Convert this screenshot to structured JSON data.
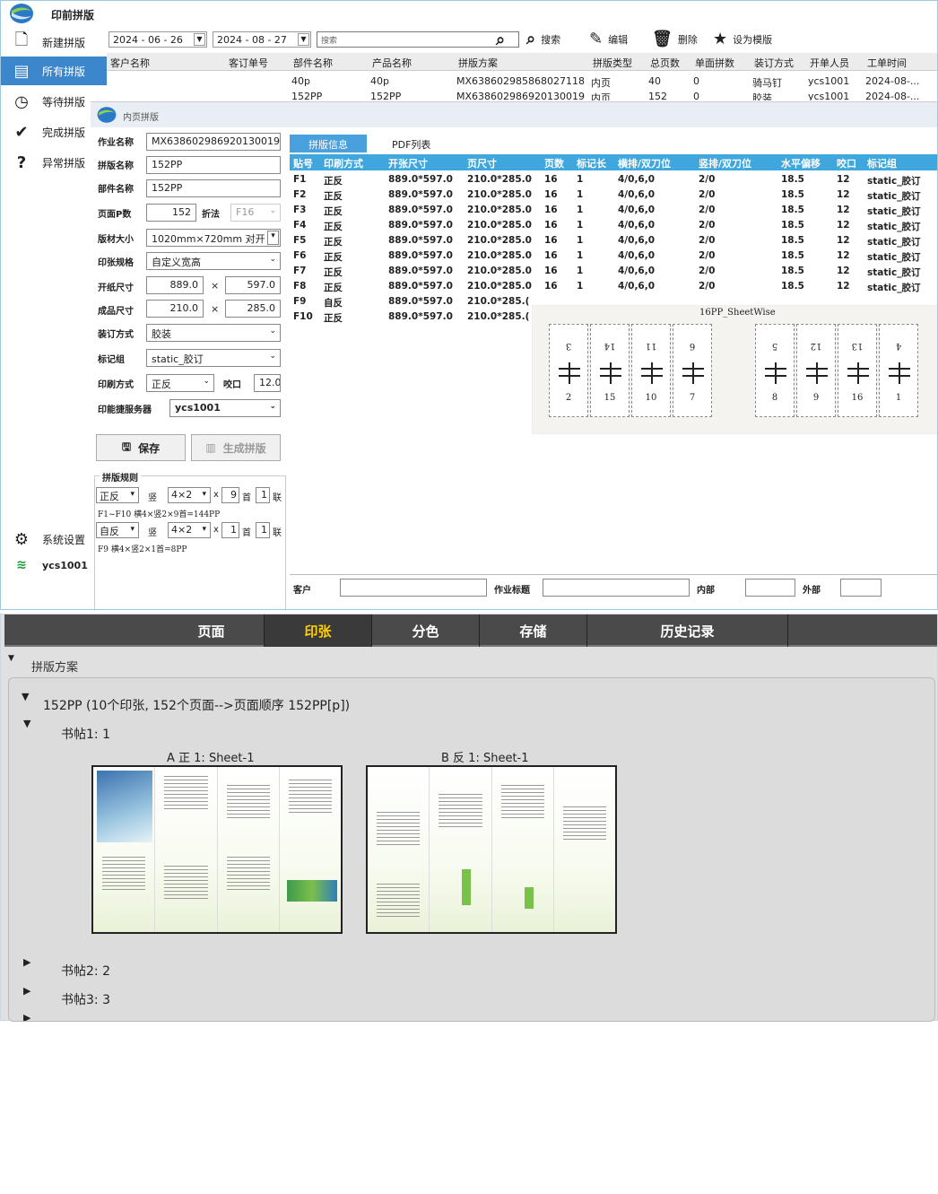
{
  "app": {
    "title": "印前拼版",
    "user": "ycs1001"
  },
  "nav": [
    {
      "label": "新建拼版",
      "icon": "new-file-icon",
      "glyph": "🗋"
    },
    {
      "label": "所有拼版",
      "icon": "list-icon",
      "glyph": "▤"
    },
    {
      "label": "等待拼版",
      "icon": "clock-icon",
      "glyph": "◷"
    },
    {
      "label": "完成拼版",
      "icon": "check-icon",
      "glyph": "✔"
    },
    {
      "label": "异常拼版",
      "icon": "question-icon",
      "glyph": "?"
    }
  ],
  "settings": {
    "label": "系统设置"
  },
  "toolbar": {
    "date_from": "2024 - 06 - 26",
    "date_to": "2024 - 08 - 27",
    "search_placeholder": "搜索",
    "search_label": "搜索",
    "edit_label": "编辑",
    "delete_label": "删除",
    "template_label": "设为模版"
  },
  "list": {
    "headers": [
      "客户名称",
      "客订单号",
      "部件名称",
      "产品名称",
      "拼版方案",
      "拼版类型",
      "总页数",
      "单面拼数",
      "装订方式",
      "开单人员",
      "工单时间"
    ],
    "rows": [
      [
        "",
        "",
        "40p",
        "40p",
        "MX638602985868027118",
        "内页",
        "40",
        "0",
        "骑马钉",
        "ycs1001",
        "2024-08-..."
      ],
      [
        "",
        "",
        "152PP",
        "152PP",
        "MX638602986920130019",
        "内页",
        "152",
        "0",
        "胶装",
        "ycs1001",
        "2024-08-..."
      ]
    ]
  },
  "dialog": {
    "title": "内页拼版",
    "job_name_label": "作业名称",
    "job_name": "MX638602986920130019",
    "layout_name_label": "拼版名称",
    "layout_name": "152PP",
    "part_name_label": "部件名称",
    "part_name": "152PP",
    "pages_label": "页面P数",
    "pages": "152",
    "fold_label": "折法",
    "fold": "F16",
    "plate_label": "版材大小",
    "plate": "1020mm×720mm 对开",
    "sheet_spec_label": "印张规格",
    "sheet_spec": "自定义宽高",
    "open_size_label": "开纸尺寸",
    "open_w": "889.0",
    "open_h": "597.0",
    "final_size_label": "成品尺寸",
    "final_w": "210.0",
    "final_h": "285.0",
    "times": "×",
    "binding_label": "装订方式",
    "binding": "胶装",
    "mark_group_label": "标记组",
    "mark_group": "static_胶订",
    "print_mode_label": "印刷方式",
    "print_mode": "正反",
    "gripper_label": "咬口",
    "gripper": "12.0",
    "server_label": "印能捷服务器",
    "server": "ycs1001",
    "save_label": "保存",
    "generate_label": "生成拼版",
    "rules_title": "拼版规则",
    "rules": [
      {
        "mode": "正反",
        "orient": "竖",
        "grid": "4×2",
        "x": "x",
        "count": "9",
        "shou": "首",
        "lian_n": "1",
        "lian": "联",
        "desc": "F1~F10 横4×竖2×9首=144PP"
      },
      {
        "mode": "自反",
        "orient": "竖",
        "grid": "4×2",
        "x": "x",
        "count": "1",
        "shou": "首",
        "lian_n": "1",
        "lian": "联",
        "desc": "F9 横4×竖2×1首=8PP"
      }
    ]
  },
  "tabs": [
    "拼版信息",
    "PDF列表"
  ],
  "grid": {
    "headers": [
      "贴号",
      "印刷方式",
      "开张尺寸",
      "页尺寸",
      "页数",
      "标记长",
      "横排/双刀位",
      "竖排/双刀位",
      "水平偏移",
      "咬口",
      "标记组"
    ],
    "rows": [
      [
        "F1",
        "正反",
        "889.0*597.0",
        "210.0*285.0",
        "16",
        "1",
        "4/0,6,0",
        "2/0",
        "18.5",
        "12",
        "static_胶订"
      ],
      [
        "F2",
        "正反",
        "889.0*597.0",
        "210.0*285.0",
        "16",
        "1",
        "4/0,6,0",
        "2/0",
        "18.5",
        "12",
        "static_胶订"
      ],
      [
        "F3",
        "正反",
        "889.0*597.0",
        "210.0*285.0",
        "16",
        "1",
        "4/0,6,0",
        "2/0",
        "18.5",
        "12",
        "static_胶订"
      ],
      [
        "F4",
        "正反",
        "889.0*597.0",
        "210.0*285.0",
        "16",
        "1",
        "4/0,6,0",
        "2/0",
        "18.5",
        "12",
        "static_胶订"
      ],
      [
        "F5",
        "正反",
        "889.0*597.0",
        "210.0*285.0",
        "16",
        "1",
        "4/0,6,0",
        "2/0",
        "18.5",
        "12",
        "static_胶订"
      ],
      [
        "F6",
        "正反",
        "889.0*597.0",
        "210.0*285.0",
        "16",
        "1",
        "4/0,6,0",
        "2/0",
        "18.5",
        "12",
        "static_胶订"
      ],
      [
        "F7",
        "正反",
        "889.0*597.0",
        "210.0*285.0",
        "16",
        "1",
        "4/0,6,0",
        "2/0",
        "18.5",
        "12",
        "static_胶订"
      ],
      [
        "F8",
        "正反",
        "889.0*597.0",
        "210.0*285.0",
        "16",
        "1",
        "4/0,6,0",
        "2/0",
        "18.5",
        "12",
        "static_胶订"
      ],
      [
        "F9",
        "自反",
        "889.0*597.0",
        "210.0*285.("
      ],
      [
        "F10",
        "正反",
        "889.0*597.0",
        "210.0*285.("
      ]
    ]
  },
  "imposition": {
    "title": "16PP_SheetWise",
    "top": [
      "3",
      "14",
      "11",
      "6",
      "5",
      "12",
      "13",
      "4"
    ],
    "bottom": [
      "2",
      "15",
      "10",
      "7",
      "8",
      "9",
      "16",
      "1"
    ]
  },
  "footer": {
    "customer_label": "客户",
    "job_title_label": "作业标题",
    "inner_label": "内部",
    "outer_label": "外部"
  },
  "bottom_nav": [
    "页面",
    "印张",
    "分色",
    "存储",
    "历史记录"
  ],
  "tree": {
    "section": "拼版方案",
    "root": "152PP (10个印张, 152个页面-->页面顺序 152PP[p])",
    "sig1": "书帖1:  1",
    "sheet_a": "A 正 1: Sheet-1",
    "sheet_b": "B 反 1: Sheet-1",
    "sig2": "书帖2:  2",
    "sig3": "书帖3:  3"
  },
  "colors": {
    "accent": "#3c87cc",
    "grid_header": "#3fa7de",
    "active_tab": "#ffd000"
  }
}
